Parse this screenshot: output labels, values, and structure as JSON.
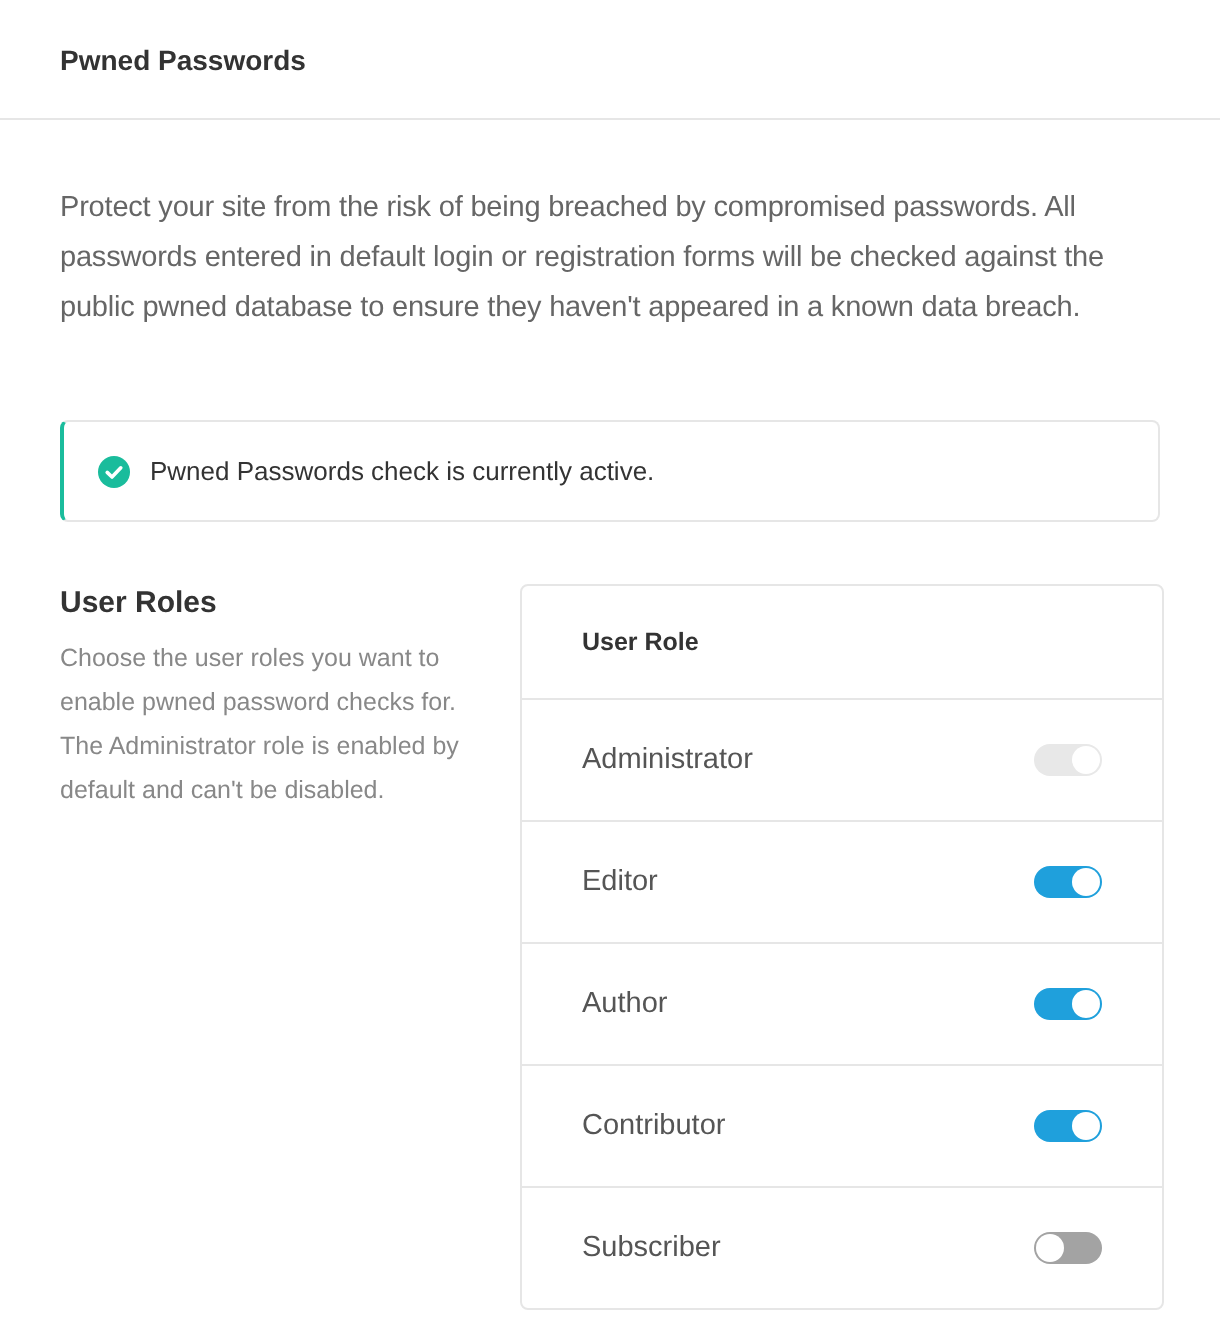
{
  "header": {
    "title": "Pwned Passwords"
  },
  "description": "Protect your site from the risk of being breached by compromised passwords. All passwords entered in default login or registration forms will be checked against the public pwned database to ensure they haven't appeared in a known data breach.",
  "notice": {
    "kind": "success",
    "text": "Pwned Passwords check is currently active."
  },
  "user_roles": {
    "title": "User Roles",
    "description": "Choose the user roles you want to enable pwned password checks for. The Administrator role is enabled by default and can't be disabled.",
    "table": {
      "columns": [
        "User Role"
      ],
      "rows": [
        {
          "role": "Administrator",
          "on": true,
          "disabled": true
        },
        {
          "role": "Editor",
          "on": true,
          "disabled": false
        },
        {
          "role": "Author",
          "on": true,
          "disabled": false
        },
        {
          "role": "Contributor",
          "on": true,
          "disabled": false
        },
        {
          "role": "Subscriber",
          "on": false,
          "disabled": false
        }
      ]
    }
  }
}
